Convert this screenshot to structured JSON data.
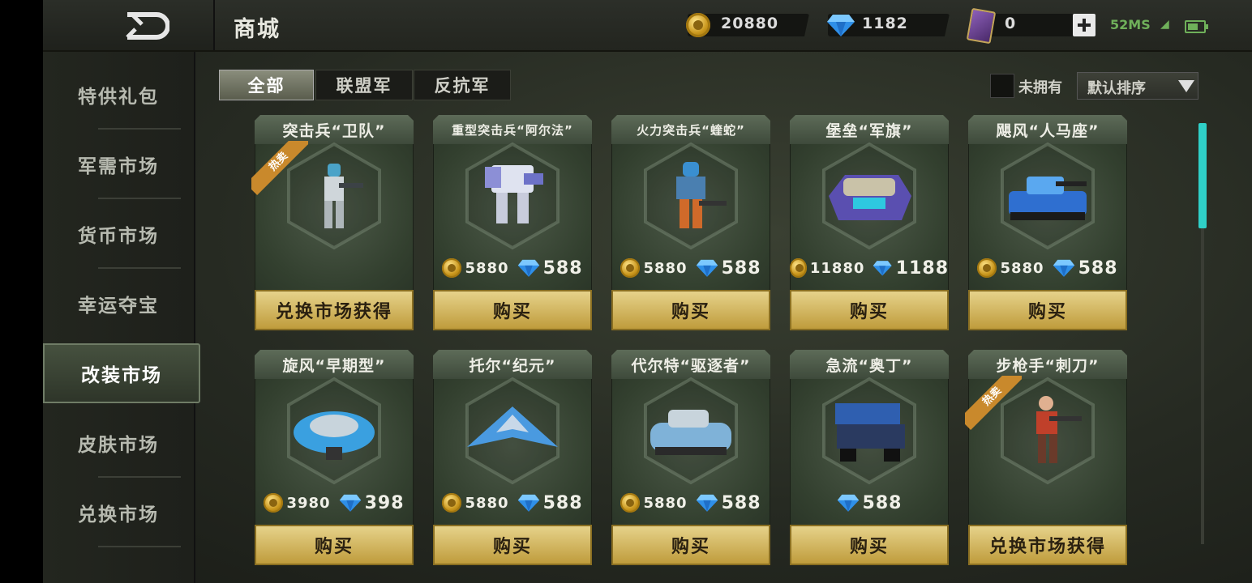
{
  "header": {
    "title": "商城",
    "gold": "20880",
    "diamond": "1182",
    "cards": "0",
    "ping": "52MS"
  },
  "sidebar": {
    "items": [
      {
        "label": "特供礼包"
      },
      {
        "label": "军需市场"
      },
      {
        "label": "货币市场"
      },
      {
        "label": "幸运夺宝"
      },
      {
        "label": "改装市场",
        "active": true
      },
      {
        "label": "皮肤市场"
      },
      {
        "label": "兑换市场"
      }
    ]
  },
  "filters": {
    "tabs": [
      {
        "label": "全部",
        "active": true
      },
      {
        "label": "联盟军"
      },
      {
        "label": "反抗军"
      }
    ],
    "unowned_label": "未拥有",
    "sort_label": "默认排序"
  },
  "products": [
    {
      "name": "突击兵“卫队”",
      "hot": "热卖",
      "button": "兑换市场获得",
      "icon": "soldier-white-icon"
    },
    {
      "name": "重型突击兵“阿尔法”",
      "gold": "5880",
      "diamond": "588",
      "button": "购买",
      "icon": "heavy-mech-icon"
    },
    {
      "name": "火力突击兵“蝰蛇”",
      "gold": "5880",
      "diamond": "588",
      "button": "购买",
      "icon": "trooper-orange-icon"
    },
    {
      "name": "堡垒“军旗”",
      "gold": "11880",
      "diamond": "1188",
      "button": "购买",
      "icon": "fortress-tank-icon"
    },
    {
      "name": "飓风“人马座”",
      "gold": "5880",
      "diamond": "588",
      "button": "购买",
      "icon": "blue-tank-icon"
    },
    {
      "name": "旋风“早期型”",
      "gold": "3980",
      "diamond": "398",
      "button": "购买",
      "icon": "hover-ship-icon"
    },
    {
      "name": "托尔“纪元”",
      "gold": "5880",
      "diamond": "588",
      "button": "购买",
      "icon": "jet-fighter-icon"
    },
    {
      "name": "代尔特“驱逐者”",
      "gold": "5880",
      "diamond": "588",
      "button": "购买",
      "icon": "hover-tank-icon"
    },
    {
      "name": "急流“奥丁”",
      "diamond": "588",
      "button": "购买",
      "icon": "artillery-vehicle-icon"
    },
    {
      "name": "步枪手“刺刀”",
      "hot": "热卖",
      "button": "兑换市场获得",
      "icon": "rifleman-red-icon"
    }
  ]
}
